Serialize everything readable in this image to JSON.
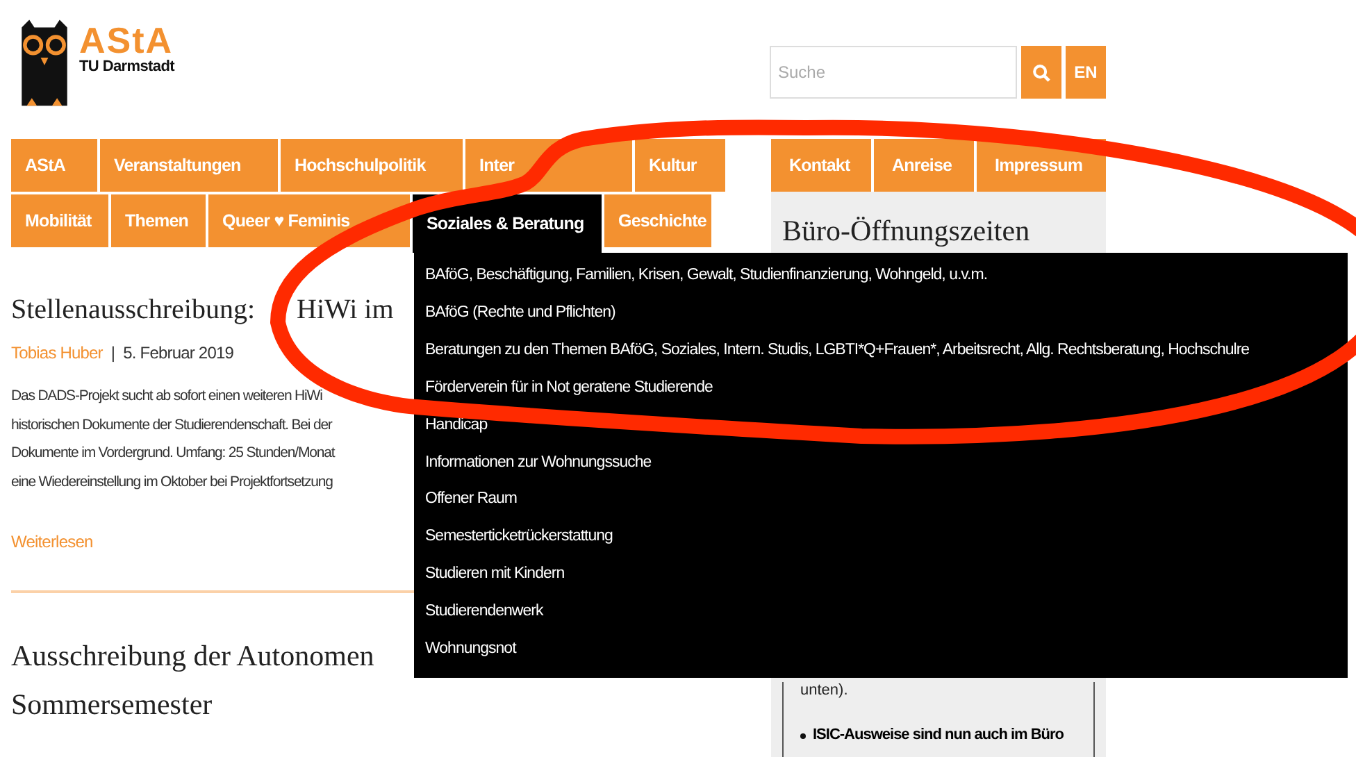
{
  "logo": {
    "title": "AStA",
    "subtitle": "TU Darmstadt"
  },
  "search": {
    "placeholder": "Suche",
    "language_button": "EN"
  },
  "main_nav": [
    [
      {
        "label": "AStA",
        "selected": false
      },
      {
        "label": "Veranstaltungen",
        "selected": false
      },
      {
        "label": "Hochschulpolitik",
        "selected": false
      },
      {
        "label": "Inter",
        "selected": false
      },
      {
        "label": "Kultur",
        "selected": false
      }
    ],
    [
      {
        "label": "Mobilität",
        "selected": false
      },
      {
        "label": "Themen",
        "selected": false
      },
      {
        "label": "Queer ♥ Feminis",
        "selected": false
      },
      {
        "label": "Soziales & Beratung",
        "selected": true
      },
      {
        "label": "Geschichte",
        "selected": false
      }
    ]
  ],
  "side_nav": [
    {
      "label": "Kontakt"
    },
    {
      "label": "Anreise"
    },
    {
      "label": "Impressum"
    }
  ],
  "dropdown": [
    "BAföG, Beschäftigung, Familien, Krisen, Gewalt, Studienfinanzierung, Wohngeld, u.v.m.",
    "BAföG (Rechte und Pflichten)",
    "Beratungen zu den Themen BAföG, Soziales, Intern. Studis, LGBTI*Q+Frauen*, Arbeitsrecht, Allg. Rechtsberatung, Hochschulre",
    "Förderverein für in Not geratene Studierende",
    "Handicap",
    "Informationen zur Wohnungssuche",
    "Offener Raum",
    "Semesterticketrückerstattung",
    "Studieren mit Kindern",
    "Studierendenwerk",
    "Wohnungsnot"
  ],
  "articles": [
    {
      "title_parts": [
        "Stellenausschreibung:",
        "HiWi im"
      ],
      "author": "Tobias Huber",
      "separator": "|",
      "date": "5. Februar 2019",
      "excerpt_lines": [
        "Das DADS-Projekt sucht ab sofort einen weiteren HiWi",
        "historischen Dokumente der Studierendenschaft. Bei der",
        "Dokumente im Vordergrund. Umfang: 25 Stunden/Monat",
        "eine Wiedereinstellung im Oktober bei Projektfortsetzung"
      ],
      "read_more": "Weiterlesen"
    },
    {
      "title_lines": [
        "Ausschreibung der Autonomen",
        "Sommersemester"
      ]
    }
  ],
  "sidebar": {
    "heading": "Büro-Öffnungszeiten",
    "text_fragment": "unten).",
    "bullet": "ISIC-Ausweise sind nun auch im Büro"
  },
  "annotation": {
    "kind": "ellipse",
    "color": "#ff2a00"
  }
}
